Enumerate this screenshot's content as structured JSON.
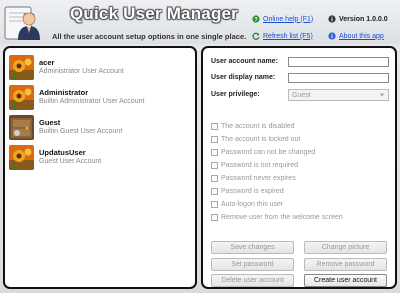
{
  "header": {
    "title": "Quick User Manager",
    "subtitle": "All the user account setup options in one single place.",
    "online_help": "Online help (F1)",
    "refresh_list": "Refresh list (F5)",
    "version": "Version 1.0.0.0",
    "about": "About this app"
  },
  "users": [
    {
      "name": "acer",
      "description": "Administrator User Account",
      "avatar": "flower-avatar"
    },
    {
      "name": "Administrator",
      "description": "Builtin Administrator User Account",
      "avatar": "flower-avatar"
    },
    {
      "name": "Guest",
      "description": "Builtin Guest User Account",
      "avatar": "guest-avatar"
    },
    {
      "name": "UpdatusUser",
      "description": "Guest User Account",
      "avatar": "flower-avatar"
    }
  ],
  "form": {
    "account_name_label": "User account name:",
    "account_name_value": "",
    "display_name_label": "User display name:",
    "display_name_value": "",
    "privilege_label": "User privilege:",
    "privilege_value": "Guest"
  },
  "options": [
    "The account is disabled",
    "The account is locked out",
    "Password can not be changed",
    "Password is not required",
    "Password never expires",
    "Password is expired",
    "Auto-logon this user",
    "Remove user from the welcome screen"
  ],
  "buttons": {
    "save_changes": "Save changes",
    "change_picture": "Change picture",
    "set_password": "Set password",
    "remove_password": "Remove password",
    "delete_user": "Delete user account",
    "create_user": "Create user account"
  },
  "colors": {
    "link": "#1a4fd0",
    "panel_border": "#111111",
    "disabled_text": "#999999"
  }
}
